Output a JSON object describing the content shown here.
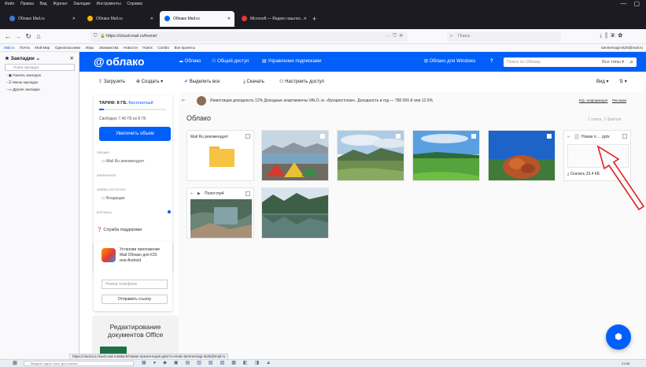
{
  "menubar": [
    "Файл",
    "Правка",
    "Вид",
    "Журнал",
    "Закладки",
    "Инструменты",
    "Справка"
  ],
  "tabs": [
    {
      "label": "Облако Mail.ru",
      "active": false,
      "fav_color": "#3a7bd5"
    },
    {
      "label": "Облако Mail.ru",
      "active": false,
      "fav_color": "#ffb300"
    },
    {
      "label": "Облако Mail.ru",
      "active": true,
      "fav_color": "#005ff9"
    },
    {
      "label": "Microsoft — Яндекс нашлос…",
      "active": false,
      "fav_color": "#e53935"
    }
  ],
  "url": "https://cloud.mail.ru/home/",
  "browser_search_placeholder": "Поиск",
  "bookmarks_bar": [
    "Mail.ru",
    "Почта",
    "Мой Мир",
    "Одноклассники",
    "Игры",
    "Знакомства",
    "Новости",
    "Поиск",
    "Combo",
    "Все проекты"
  ],
  "account_email": "tammemagi-ds25@mail.ru",
  "sidepanel": {
    "title": "Закладки",
    "search_placeholder": "Поиск закладок",
    "items": [
      "Панель закладок",
      "Меню закладок",
      "Другие закладки"
    ]
  },
  "header": {
    "logo": "облако",
    "nav": [
      "Облако",
      "Общий доступ",
      "Управление подписками"
    ],
    "windows_app": "Облако для Windows",
    "search_placeholder": "Поиск по Облаку",
    "all_types": "Все типы"
  },
  "toolbar": {
    "upload": "Загрузить",
    "create": "Создать",
    "select_all": "Выделить все",
    "download": "Скачать",
    "share": "Настроить доступ",
    "view": "Вид"
  },
  "tariff": {
    "label": "ТАРИФ: 8 ГБ.",
    "plan": "Бесплатный",
    "free_text": "Свободно 7.46 ГБ из 8 ГБ",
    "used_fraction": 0.07,
    "increase_button": "Увеличить объем"
  },
  "folders_tree": {
    "cloud_label": "ОБЛАКО",
    "cloud_item": "Mail Ru рекомендует",
    "favorites_label": "ИЗБРАННОЕ",
    "mail_files_label": "ФАЙЛЫ ИЗ ПОЧТЫ",
    "mail_item": "Входящие",
    "trash_label": "КОРЗИНА"
  },
  "support": "Служба поддержки",
  "promo": {
    "text": "Установи приложение Mail Облако для iOS или Android",
    "phone_placeholder": "Номер телефона",
    "send_button": "Отправить ссылку"
  },
  "office_promo": "Редактирование документов Office",
  "ad_banner": {
    "text": "Инвестиции доходность 12%   Доходные апартаменты VALO, м. «Бухарестская». Доходность в год — 780 000 ₽ или 12.5%",
    "legal": "Юр. информация",
    "label": "Реклама"
  },
  "content": {
    "title": "Облако",
    "counts": "1 папка, 7 файлов",
    "folder_tile": "Mail Ru рекомендует",
    "pptx_tile": "Новая п… .pptx",
    "pptx_download": "Скачать 33.4 КБ",
    "flight_tile": "Полет.mp4"
  },
  "status_url": "https://cloclo14.cloud.mail.ru/attach/Новая презентация.pptx?x-email=tammemagi-ds25@mail.ru",
  "taskbar_search": "Введите здесь текст для поиска",
  "taskbar_time": "21:06",
  "colors": {
    "brand_blue": "#005ff9",
    "annotation_arrow": "#e02020"
  }
}
